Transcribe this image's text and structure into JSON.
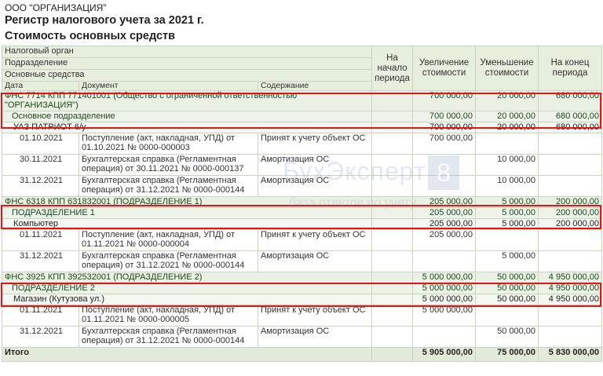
{
  "header": {
    "org": "ООО \"ОРГАНИЗАЦИЯ\"",
    "title": "Регистр налогового учета за 2021 г.",
    "subtitle": "Стоимость основных средств"
  },
  "columns": {
    "tax_authority": "Налоговый орган",
    "division": "Подразделение",
    "fixed_assets": "Основные средства",
    "date": "Дата",
    "document": "Документ",
    "content": "Содержание",
    "start": "На начало периода",
    "increase": "Увеличение стоимости",
    "decrease": "Уменьшение стоимости",
    "end": "На конец периода"
  },
  "groups": [
    {
      "org_name": "ФНС 7714 КПП 771401001 (Общество с ограниченной ответственностью \"ОРГАНИЗАЦИЯ\")",
      "org_increase": "700 000,00",
      "org_decrease": "20 000,00",
      "org_end": "680 000,00",
      "sub_name": "Основное подразделение",
      "sub_increase": "700 000,00",
      "sub_decrease": "20 000,00",
      "sub_end": "680 000,00",
      "asset_name": "УАЗ ПАТРИОТ 6/у",
      "asset_increase": "700 000,00",
      "asset_decrease": "20 000,00",
      "asset_end": "680 000,00",
      "docs": [
        {
          "date": "01.10.2021",
          "document": "Поступление (акт, накладная, УПД) от 01.10.2021 № 0000-000003",
          "content": "Принят к учету объект ОС",
          "increase": "700 000,00",
          "decrease": ""
        },
        {
          "date": "30.11.2021",
          "document": "Бухгалтерская справка (Регламентная операция) от 30.11.2021 № 0000-000137",
          "content": "Амортизация ОС",
          "increase": "",
          "decrease": "10 000,00"
        },
        {
          "date": "31.12.2021",
          "document": "Бухгалтерская справка (Регламентная операция) от 31.12.2021 № 0000-000144",
          "content": "Амортизация ОС",
          "increase": "",
          "decrease": "10 000,00"
        }
      ]
    },
    {
      "org_name": "ФНС 6318 КПП 631832001 (ПОДРАЗДЕЛЕНИЕ 1)",
      "org_increase": "205 000,00",
      "org_decrease": "5 000,00",
      "org_end": "200 000,00",
      "sub_name": "ПОДРАЗДЕЛЕНИЕ 1",
      "sub_increase": "205 000,00",
      "sub_decrease": "5 000,00",
      "sub_end": "200 000,00",
      "asset_name": "Компьютер",
      "asset_increase": "205 000,00",
      "asset_decrease": "5 000,00",
      "asset_end": "200 000,00",
      "docs": [
        {
          "date": "01.11.2021",
          "document": "Поступление (акт, накладная, УПД) от 01.11.2021 № 0000-000004",
          "content": "Принят к учету объект ОС",
          "increase": "205 000,00",
          "decrease": ""
        },
        {
          "date": "31.12.2021",
          "document": "Бухгалтерская справка (Регламентная операция) от 31.12.2021 № 0000-000144",
          "content": "Амортизация ОС",
          "increase": "",
          "decrease": "5 000,00"
        }
      ]
    },
    {
      "org_name": "ФНС 3925 КПП 392532001 (ПОДРАЗДЕЛЕНИЕ 2)",
      "org_increase": "5 000 000,00",
      "org_decrease": "50 000,00",
      "org_end": "4 950 000,00",
      "sub_name": "ПОДРАЗДЕЛЕНИЕ 2",
      "sub_increase": "5 000 000,00",
      "sub_decrease": "50 000,00",
      "sub_end": "4 950 000,00",
      "asset_name": "Магазин (Кутузова ул.)",
      "asset_increase": "5 000 000,00",
      "asset_decrease": "50 000,00",
      "asset_end": "4 950 000,00",
      "docs": [
        {
          "date": "01.11.2021",
          "document": "Поступление (акт, накладная, УПД) от 01.11.2021 № 0000-000005",
          "content": "Принят к учету объект ОС",
          "increase": "5 000 000,00",
          "decrease": ""
        },
        {
          "date": "31.12.2021",
          "document": "Бухгалтерская справка (Регламентная операция) от 31.12.2021 № 0000-000144",
          "content": "Амортизация ОС",
          "increase": "",
          "decrease": "50 000,00"
        }
      ]
    }
  ],
  "total": {
    "label": "Итого",
    "increase": "5 905 000,00",
    "decrease": "75 000,00",
    "end": "5 830 000,00"
  },
  "watermark": {
    "text": "БухЭксперт",
    "badge": "8",
    "sub": "база ответов по учету"
  },
  "highlight_color": "#e21515"
}
